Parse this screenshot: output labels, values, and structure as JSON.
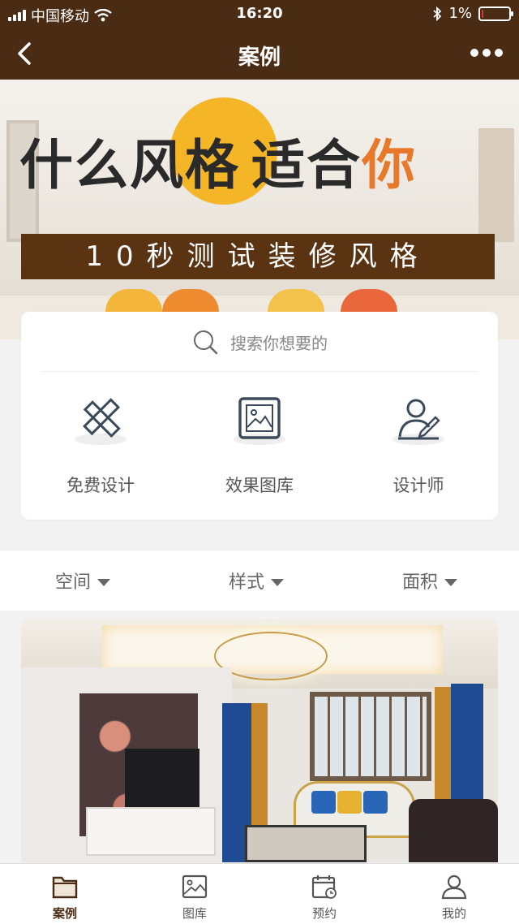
{
  "status_bar": {
    "carrier": "中国移动",
    "time": "16:20",
    "battery_percent": "1%",
    "battery_level": 0.01
  },
  "nav": {
    "title": "案例"
  },
  "banner": {
    "headline_part1": "什么风格",
    "headline_part2": "适合",
    "headline_part3": "你",
    "subheadline": "10秒测试装修风格"
  },
  "search": {
    "placeholder": "搜索你想要的"
  },
  "quick_actions": [
    {
      "label": "免费设计",
      "icon": "pencil-ruler-icon"
    },
    {
      "label": "效果图库",
      "icon": "picture-icon"
    },
    {
      "label": "设计师",
      "icon": "designer-icon"
    }
  ],
  "filters": [
    {
      "label": "空间"
    },
    {
      "label": "样式"
    },
    {
      "label": "面积"
    }
  ],
  "tabs": [
    {
      "label": "案例",
      "icon": "folder-icon",
      "active": true
    },
    {
      "label": "图库",
      "icon": "image-icon",
      "active": false
    },
    {
      "label": "预约",
      "icon": "calendar-clock-icon",
      "active": false
    },
    {
      "label": "我的",
      "icon": "user-icon",
      "active": false
    }
  ],
  "colors": {
    "brand_brown": "#4a2b13",
    "banner_band": "#5a3312",
    "banner_sun": "#f4b526",
    "accent_orange": "#e8792a",
    "battery_low": "#e33333"
  }
}
